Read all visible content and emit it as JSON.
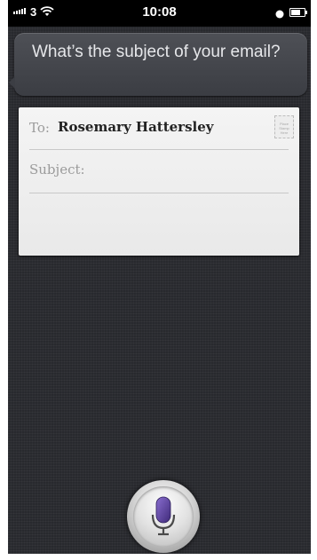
{
  "status_bar": {
    "carrier": "3",
    "time": "10:08",
    "signal_bars": 5,
    "battery_level": 0.8
  },
  "siri": {
    "prompt": "What’s the subject of your email?"
  },
  "email": {
    "to_label": "To:",
    "recipient": "Rosemary Hattersley",
    "subject_label": "Subject:",
    "subject_value": "",
    "body": "",
    "stamp_text": "Place Stamp Here"
  },
  "mic": {
    "icon": "microphone-icon",
    "accent_color": "#5b3f9c"
  },
  "colors": {
    "background": "#2b2c31",
    "bubble": "#45474d",
    "card": "#f1f1f1"
  }
}
